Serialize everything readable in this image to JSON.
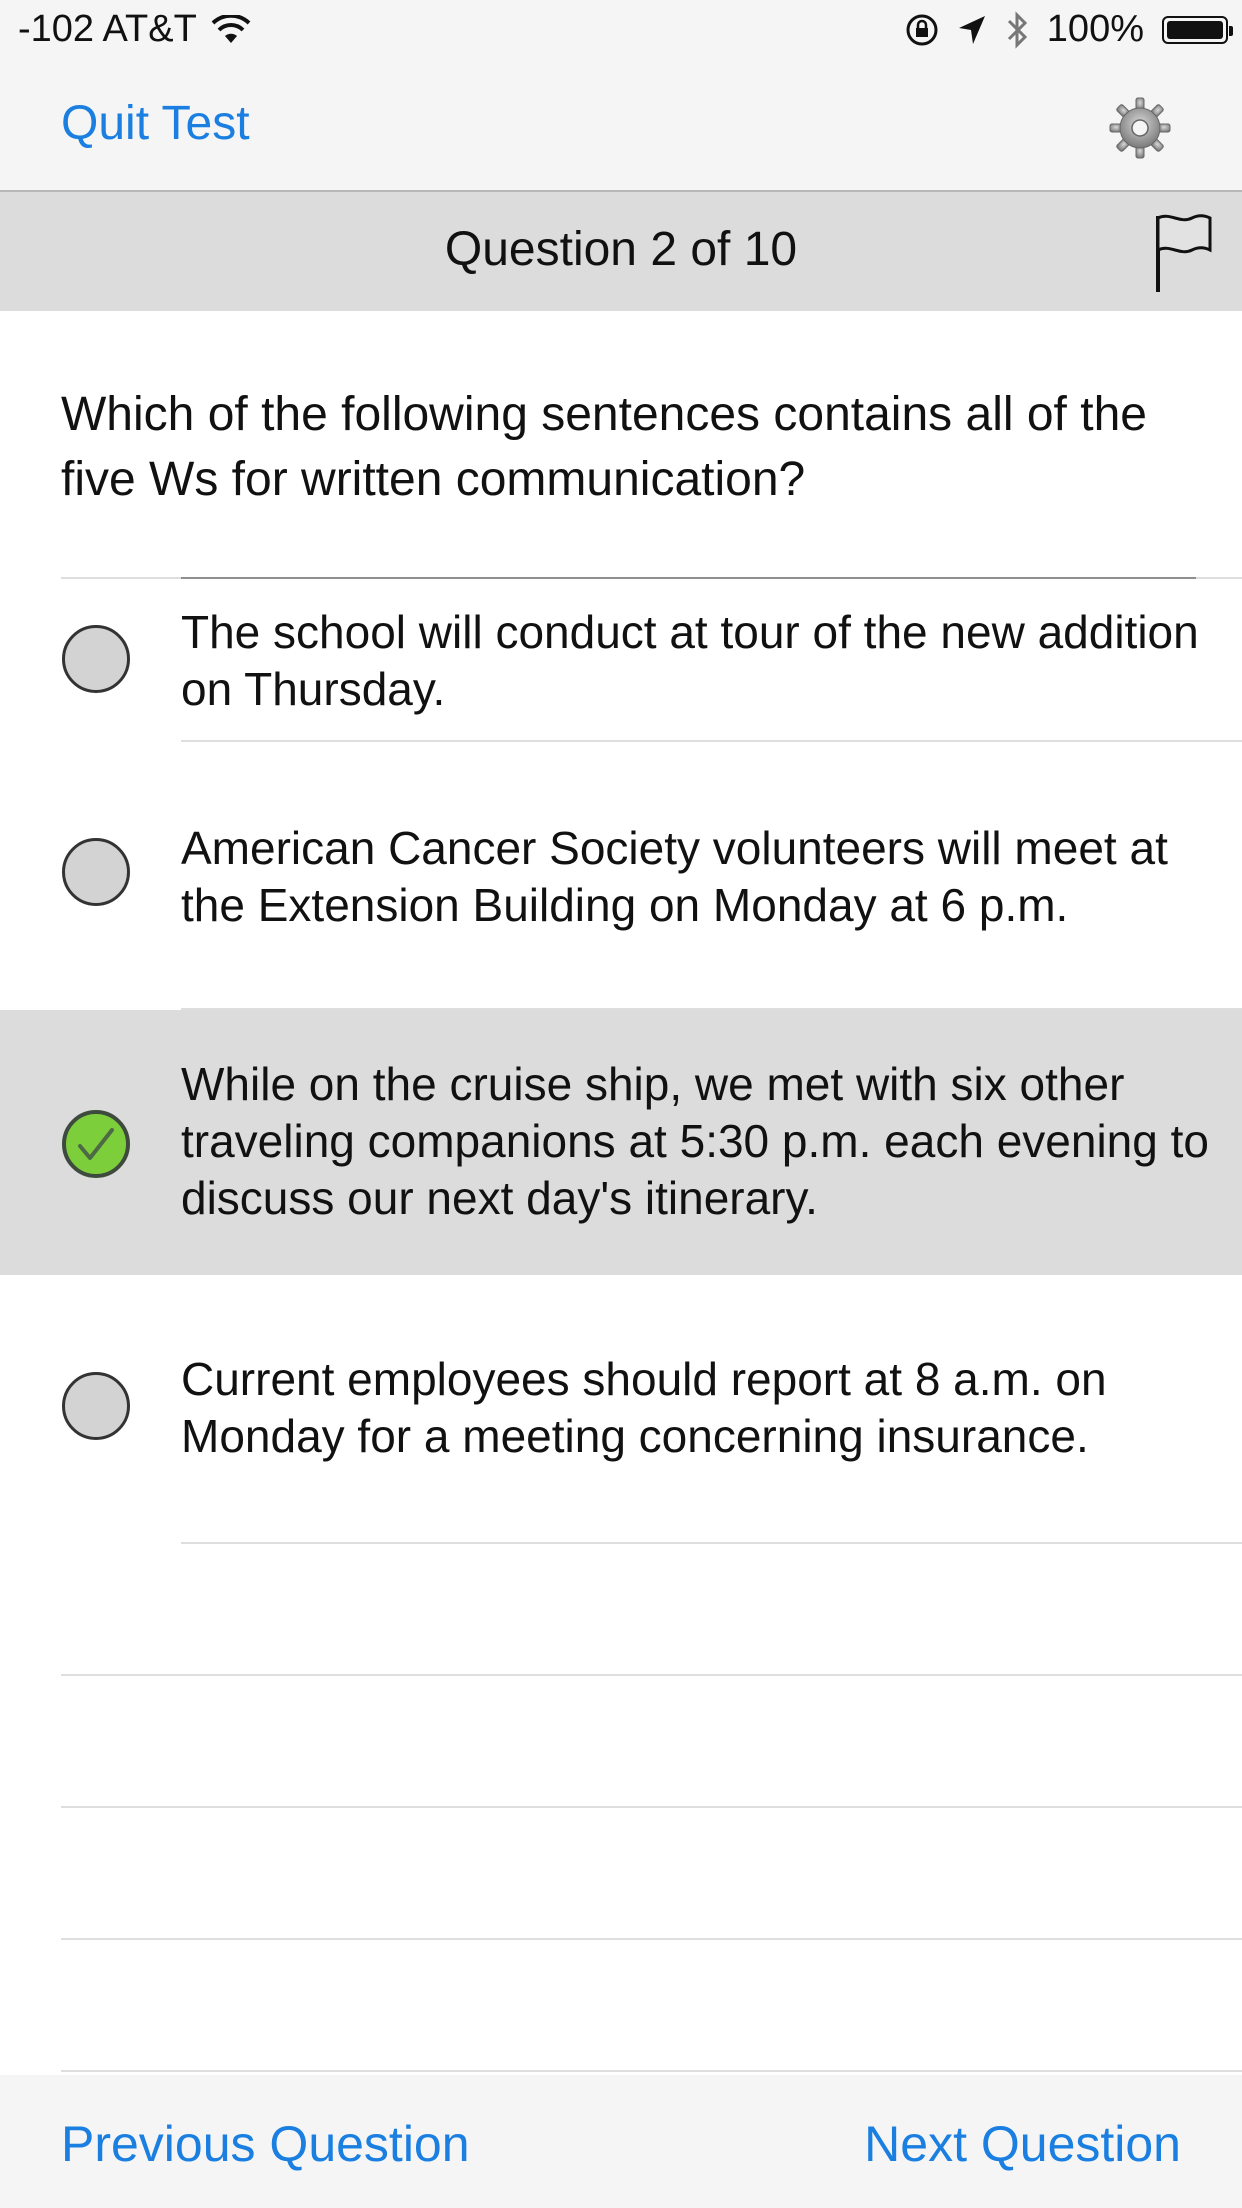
{
  "status_bar": {
    "carrier": "-102 AT&T",
    "battery": "100%",
    "icons": [
      "wifi-icon",
      "orientation-lock-icon",
      "location-arrow-icon",
      "bluetooth-icon",
      "battery-icon"
    ]
  },
  "nav": {
    "quit_label": "Quit Test",
    "settings_icon": "gear-icon"
  },
  "question_header": {
    "counter": "Question 2 of 10",
    "flag_icon": "flag-icon"
  },
  "question": {
    "text": "Which of the following sentences contains all of the five Ws for written communication?"
  },
  "answers": [
    {
      "text": "The school will conduct at tour of the new addition on Thursday.",
      "selected": false
    },
    {
      "text": "American Cancer Society volunteers will meet at the Extension Building on Monday at 6 p.m.",
      "selected": false
    },
    {
      "text": "While on the cruise ship, we met with six other traveling companions at 5:30 p.m. each evening to discuss our next day's itinerary.",
      "selected": true
    },
    {
      "text": "Current employees should report at 8 a.m. on Monday for a meeting concerning insurance.",
      "selected": false
    }
  ],
  "footer": {
    "previous_label": "Previous Question",
    "next_label": "Next Question"
  },
  "colors": {
    "accent": "#1a7fe0",
    "selected_row": "#dcdcdc",
    "check_green": "#7ccf3b"
  }
}
